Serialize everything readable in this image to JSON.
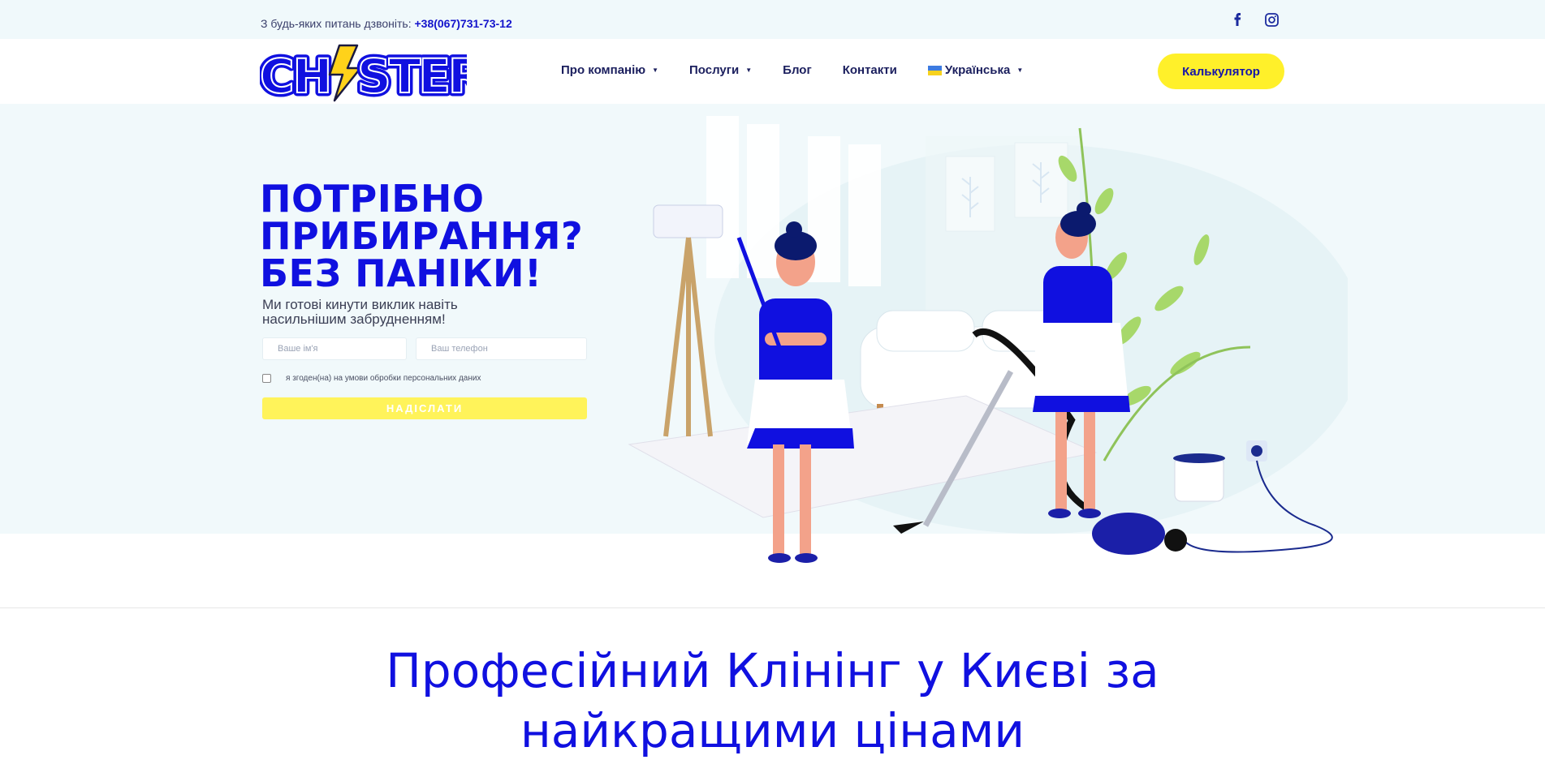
{
  "topbar": {
    "call_text": "З будь-яких питань дзвоніть:",
    "phone": "+38(067)731-73-12",
    "social": [
      {
        "icon": "facebook-icon",
        "label": "f"
      },
      {
        "icon": "instagram-icon",
        "label": ""
      }
    ]
  },
  "header": {
    "logo_text": "CHISTER",
    "nav": [
      {
        "label": "Про компанію",
        "has_dropdown": true
      },
      {
        "label": "Послуги",
        "has_dropdown": true
      },
      {
        "label": "Блог",
        "has_dropdown": false
      },
      {
        "label": "Контакти",
        "has_dropdown": false
      },
      {
        "label": "Українська",
        "has_dropdown": true,
        "flag": "ukraine-flag-icon"
      }
    ],
    "cta_label": "Калькулятор"
  },
  "hero": {
    "title_lines": [
      "ПОТРІБНО",
      "ПРИБИРАННЯ?",
      "БЕЗ ПАНІКИ!"
    ],
    "subtitle_line1": "Ми готові кинути виклик навіть",
    "subtitle_line2": "насильнішим забрудненням!",
    "form": {
      "name_placeholder": "Ваше ім'я",
      "phone_placeholder": "Ваш телефон",
      "consent_label": "я згоден(на) на умови обробки персональних даних",
      "submit_label": "НАДІСЛАТИ"
    }
  },
  "section": {
    "headline_line1": "Професійний Клінінг у Києві за",
    "headline_line2": "найкращими цінами"
  },
  "colors": {
    "brand_blue": "#1010e0",
    "brand_yellow": "#fff02a",
    "hero_bg": "#f1f9fb",
    "navy": "#1b1f5e"
  }
}
